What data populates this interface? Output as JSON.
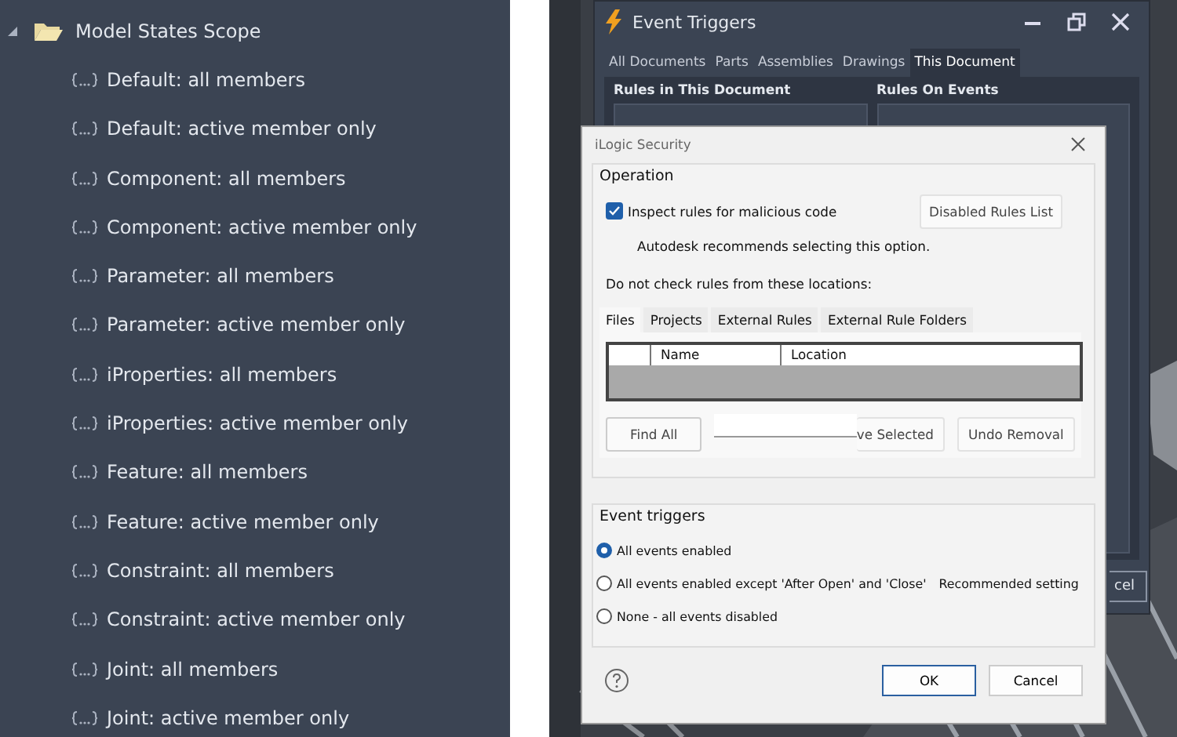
{
  "tree": {
    "label": "Model States Scope",
    "expanded": true,
    "children": [
      {
        "label": "Default: all members"
      },
      {
        "label": "Default: active member only"
      },
      {
        "label": "Component: all members"
      },
      {
        "label": "Component: active member only"
      },
      {
        "label": "Parameter: all members"
      },
      {
        "label": "Parameter: active member only"
      },
      {
        "label": "iProperties: all members"
      },
      {
        "label": "iProperties: active member only"
      },
      {
        "label": "Feature: all members"
      },
      {
        "label": "Feature: active member only"
      },
      {
        "label": "Constraint: all members"
      },
      {
        "label": "Constraint: active member only"
      },
      {
        "label": "Joint: all members"
      },
      {
        "label": "Joint: active member only"
      }
    ]
  },
  "event_triggers": {
    "title": "Event Triggers",
    "tabs": [
      {
        "label": "All Documents",
        "selected": false
      },
      {
        "label": "Parts",
        "selected": false
      },
      {
        "label": "Assemblies",
        "selected": false
      },
      {
        "label": "Drawings",
        "selected": false
      },
      {
        "label": "This Document",
        "selected": true
      }
    ],
    "left_heading": "Rules in This Document",
    "right_heading": "Rules On Events",
    "cancel_fragment": "cel"
  },
  "dialog": {
    "title": "iLogic Security",
    "operation": {
      "legend": "Operation",
      "inspect": {
        "label": "Inspect rules for malicious code",
        "checked": true
      },
      "disabled_rules_button": "Disabled Rules List",
      "note": "Autodesk recommends selecting this option.",
      "locations_label": "Do not check rules from these locations:",
      "tabs": [
        {
          "label": "Files",
          "selected": true
        },
        {
          "label": "Projects",
          "selected": false
        },
        {
          "label": "External Rules",
          "selected": false
        },
        {
          "label": "External Rule Folders",
          "selected": false
        }
      ],
      "table": {
        "columns": [
          "Name",
          "Location"
        ]
      },
      "buttons": [
        "Find All",
        "ve Selected",
        "Undo Removal"
      ]
    },
    "event_triggers": {
      "legend": "Event triggers",
      "options": [
        {
          "label": "All events enabled",
          "selected": true
        },
        {
          "label": "All events enabled except 'After Open' and 'Close'",
          "selected": false,
          "note": "Recommended setting"
        },
        {
          "label": "None - all events disabled",
          "selected": false
        }
      ]
    },
    "footer": [
      {
        "label": "OK",
        "default": true
      },
      {
        "label": "Cancel",
        "default": false
      }
    ]
  }
}
